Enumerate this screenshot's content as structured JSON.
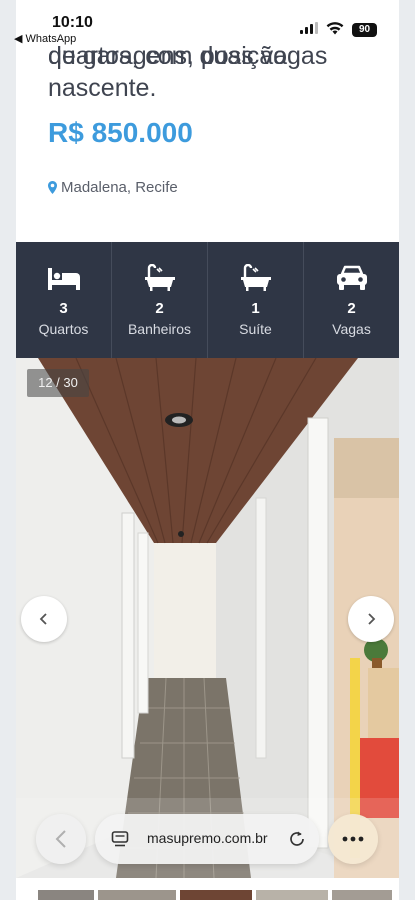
{
  "status_bar": {
    "time": "10:10",
    "back_app": "◀ WhatsApp",
    "battery": "90"
  },
  "listing": {
    "title_lines": [
      "quartos, com duas vagas",
      "de garagens, posição",
      "nascente."
    ],
    "price": "R$ 850.000",
    "location": "Madalena, Recife"
  },
  "features": [
    {
      "icon": "bed-icon",
      "count": "3",
      "label": "Quartos"
    },
    {
      "icon": "bathtub-icon",
      "count": "2",
      "label": "Banheiros"
    },
    {
      "icon": "bathtub-icon",
      "count": "1",
      "label": "Suíte"
    },
    {
      "icon": "car-icon",
      "count": "2",
      "label": "Vagas"
    }
  ],
  "gallery": {
    "counter": "12 / 30"
  },
  "browser": {
    "url": "masupremo.com.br"
  },
  "colors": {
    "price": "#3d9bdd",
    "features_bg": "#2f3645",
    "card_bg": "#ffffff"
  }
}
